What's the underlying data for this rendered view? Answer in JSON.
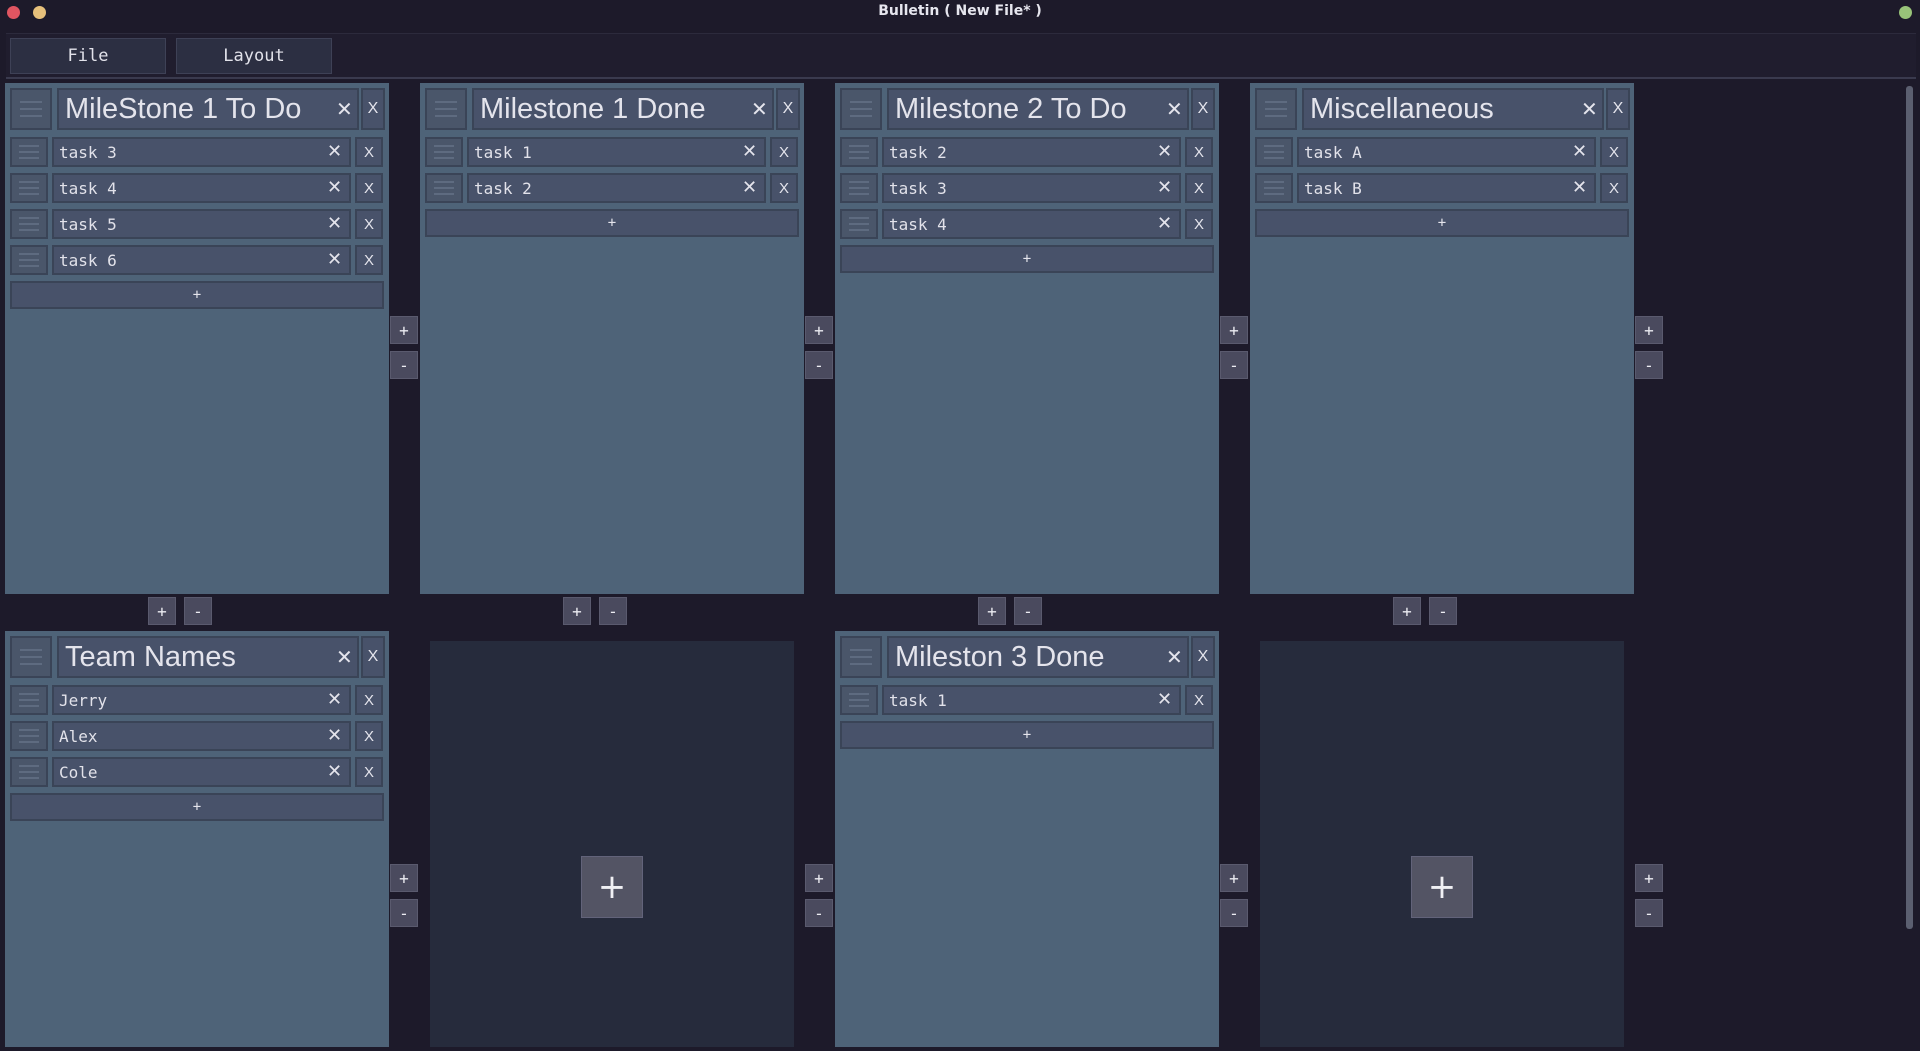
{
  "window": {
    "title": "Bulletin ( New File* )",
    "colors": {
      "close": "#e05561",
      "minimize": "#e6c07b",
      "maximize": "#98c379"
    }
  },
  "menu": {
    "file_label": "File",
    "layout_label": "Layout"
  },
  "lists": {
    "m1_todo": {
      "title": "MileStone 1 To Do",
      "items": [
        "task 3",
        "task 4",
        "task 5",
        "task 6"
      ]
    },
    "m1_done": {
      "title": "Milestone 1 Done",
      "items": [
        "task 1",
        "task 2"
      ]
    },
    "m2_todo": {
      "title": "Milestone 2 To Do",
      "items": [
        "task 2",
        "task 3",
        "task 4"
      ]
    },
    "misc": {
      "title": "Miscellaneous",
      "items": [
        "task A",
        "task B"
      ]
    },
    "team": {
      "title": "Team Names",
      "items": [
        "Jerry",
        "Alex",
        "Cole"
      ]
    },
    "m3_done": {
      "title": "Mileston 3 Done",
      "items": [
        "task 1"
      ]
    }
  },
  "controls": {
    "plus": "+",
    "minus": "-",
    "remove": "X",
    "clear": "✕",
    "add_item": "+"
  }
}
